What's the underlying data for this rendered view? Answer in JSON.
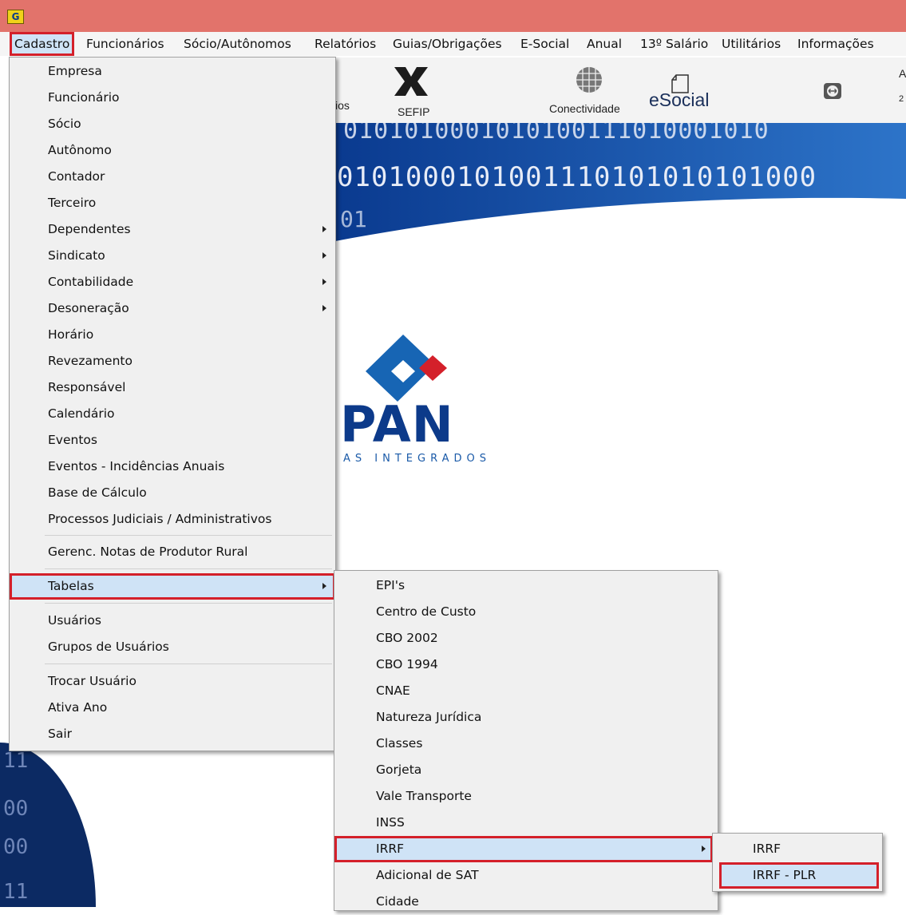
{
  "menubar": {
    "items": [
      "Cadastro",
      "Funcionários",
      "Sócio/Autônomos",
      "Relatórios",
      "Guias/Obrigações",
      "E-Social",
      "Anual",
      "13º Salário",
      "Utilitários",
      "Informações"
    ]
  },
  "toolbar": {
    "partial_label": "ios",
    "sefip": "SEFIP",
    "conectividade": "Conectividade",
    "esocial": "eSocial",
    "edge_char_1": "A",
    "edge_char_2": "2"
  },
  "background": {
    "binary_row_1": "0101010001010100111010001010",
    "binary_row_2": "0101000101001110101010101000",
    "binary_row_3": "01",
    "logo_text": "PAN",
    "logo_tagline": "AS INTEGRADOS",
    "left_binary": [
      "11",
      "00",
      "00",
      "11"
    ]
  },
  "cadastro_menu": {
    "items": [
      {
        "label": "Empresa",
        "has_submenu": false
      },
      {
        "label": "Funcionário",
        "has_submenu": false
      },
      {
        "label": "Sócio",
        "has_submenu": false
      },
      {
        "label": "Autônomo",
        "has_submenu": false
      },
      {
        "label": "Contador",
        "has_submenu": false
      },
      {
        "label": "Terceiro",
        "has_submenu": false
      },
      {
        "label": "Dependentes",
        "has_submenu": true
      },
      {
        "label": "Sindicato",
        "has_submenu": true
      },
      {
        "label": "Contabilidade",
        "has_submenu": true
      },
      {
        "label": "Desoneração",
        "has_submenu": true
      },
      {
        "label": "Horário",
        "has_submenu": false
      },
      {
        "label": "Revezamento",
        "has_submenu": false
      },
      {
        "label": "Responsável",
        "has_submenu": false
      },
      {
        "label": "Calendário",
        "has_submenu": false
      },
      {
        "label": "Eventos",
        "has_submenu": false
      },
      {
        "label": "Eventos - Incidências Anuais",
        "has_submenu": false
      },
      {
        "label": "Base de Cálculo",
        "has_submenu": false
      },
      {
        "label": "Processos Judiciais / Administrativos",
        "has_submenu": false
      },
      {
        "label": "Gerenc. Notas de Produtor Rural",
        "has_submenu": false
      },
      {
        "label": "Tabelas",
        "has_submenu": true
      },
      {
        "label": "Usuários",
        "has_submenu": false
      },
      {
        "label": "Grupos de Usuários",
        "has_submenu": false
      },
      {
        "label": "Trocar Usuário",
        "has_submenu": false
      },
      {
        "label": "Ativa Ano",
        "has_submenu": false
      },
      {
        "label": "Sair",
        "has_submenu": false
      }
    ]
  },
  "tabelas_menu": {
    "items": [
      {
        "label": "EPI's",
        "has_submenu": false
      },
      {
        "label": "Centro de Custo",
        "has_submenu": false
      },
      {
        "label": "CBO 2002",
        "has_submenu": false
      },
      {
        "label": "CBO 1994",
        "has_submenu": false
      },
      {
        "label": "CNAE",
        "has_submenu": false
      },
      {
        "label": "Natureza Jurídica",
        "has_submenu": false
      },
      {
        "label": "Classes",
        "has_submenu": false
      },
      {
        "label": "Gorjeta",
        "has_submenu": false
      },
      {
        "label": "Vale Transporte",
        "has_submenu": false
      },
      {
        "label": "INSS",
        "has_submenu": false
      },
      {
        "label": "IRRF",
        "has_submenu": true
      },
      {
        "label": "Adicional de SAT",
        "has_submenu": false
      },
      {
        "label": "Cidade",
        "has_submenu": false
      }
    ]
  },
  "irrf_menu": {
    "items": [
      {
        "label": "IRRF"
      },
      {
        "label": "IRRF - PLR"
      }
    ]
  },
  "highlight_color": "#d4202a",
  "selection_color": "#cfe3f6",
  "brand_blue": "#0c3a8a"
}
